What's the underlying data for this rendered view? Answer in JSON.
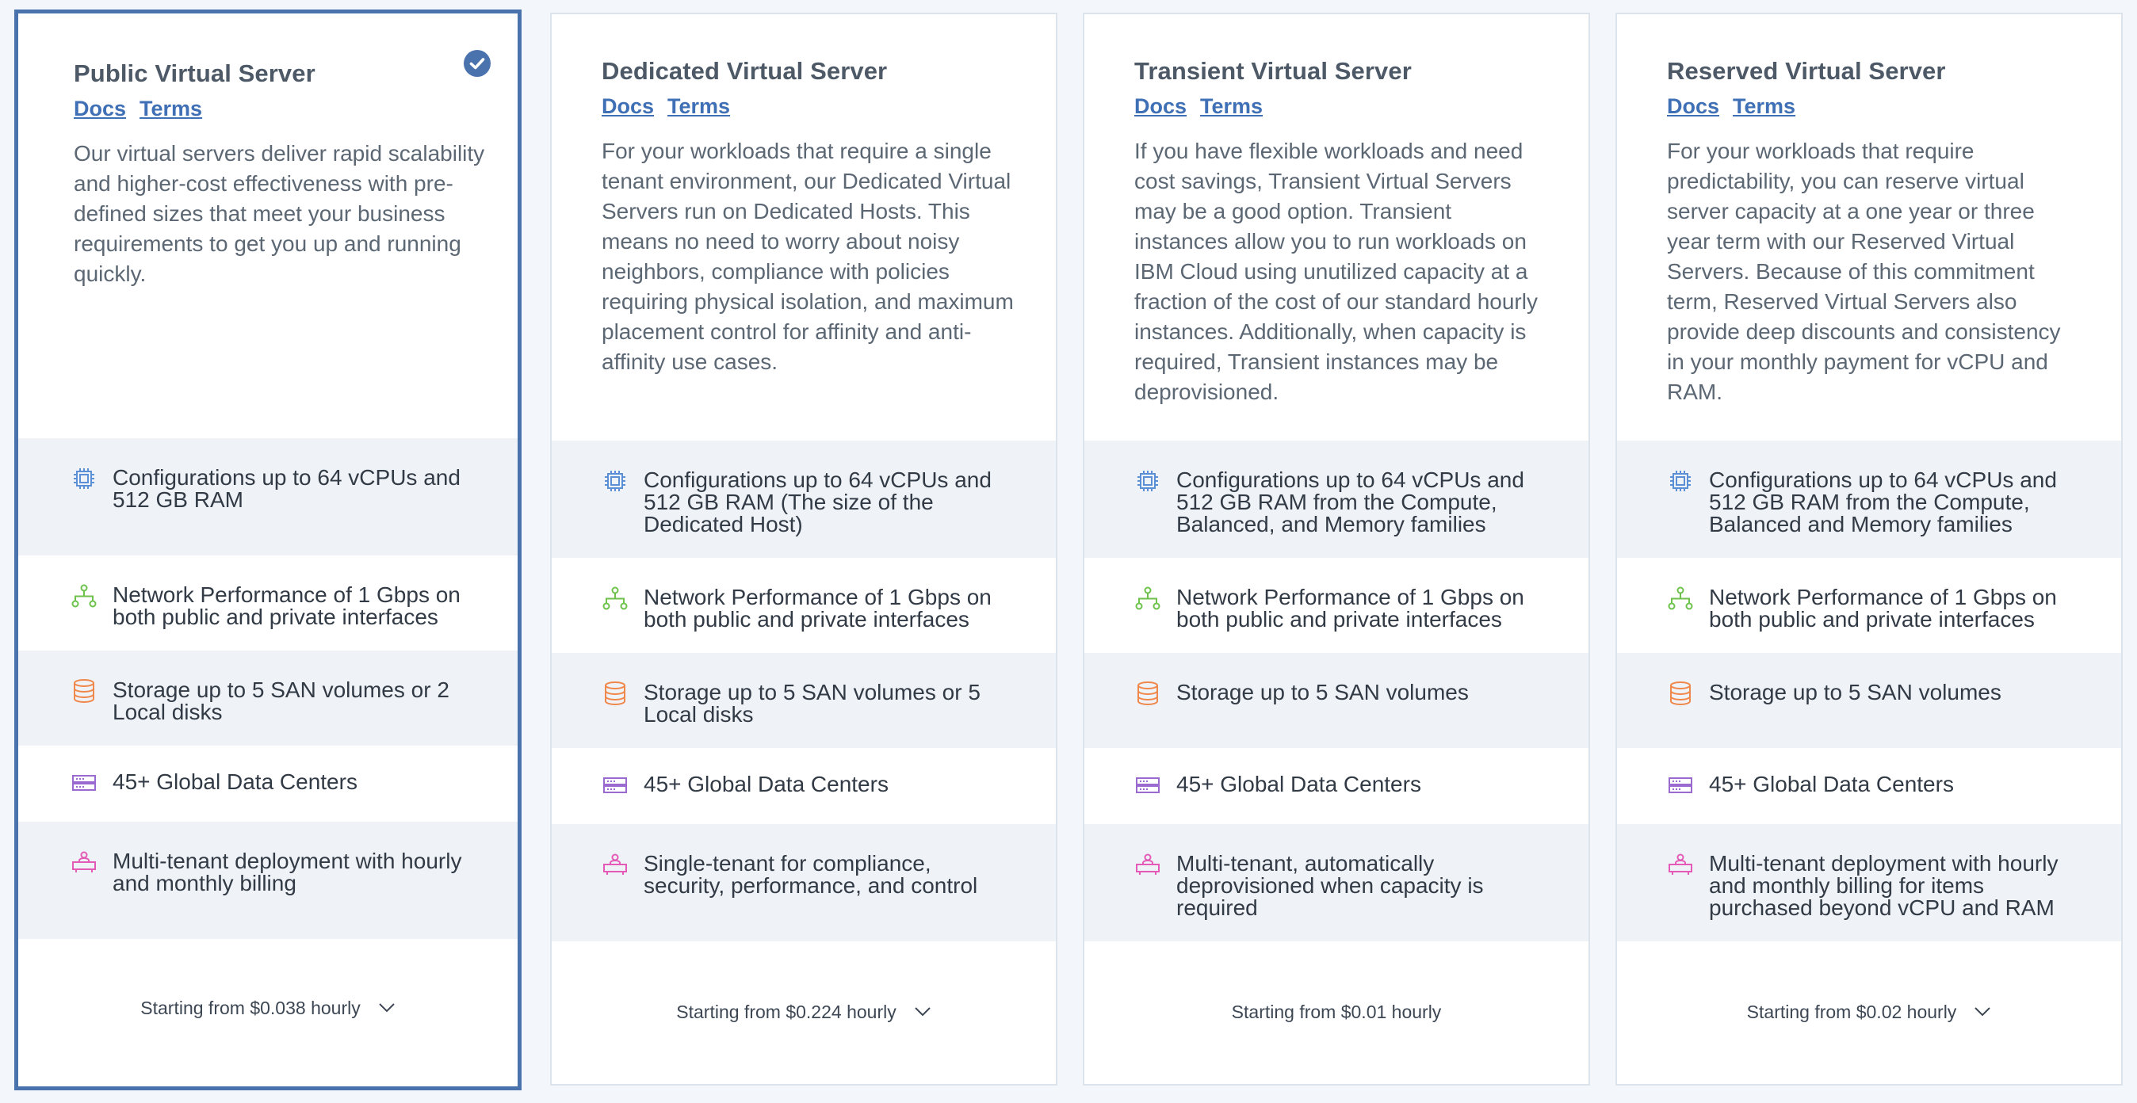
{
  "cards": [
    {
      "title": "Public Virtual Server",
      "docs": "Docs",
      "terms": "Terms",
      "description": "Our virtual servers deliver rapid scalability and higher-cost effectiveness with pre-defined sizes that meet your business requirements to get you up and running quickly.",
      "features": [
        "Configurations up to 64 vCPUs and 512 GB RAM",
        "Network Performance of 1 Gbps on both public and private interfaces",
        "Storage up to 5 SAN volumes or 2 Local disks",
        "45+ Global Data Centers",
        "Multi-tenant deployment with hourly and monthly billing"
      ],
      "price": "Starting from $0.038 hourly",
      "selected": true
    },
    {
      "title": "Dedicated Virtual Server",
      "docs": "Docs",
      "terms": "Terms",
      "description": "For your workloads that require a single tenant environment, our Dedicated Virtual Servers run on Dedicated Hosts. This means no need to worry about noisy neighbors, compliance with policies requiring physical isolation, and maximum placement control for affinity and anti-affinity use cases.",
      "features": [
        "Configurations up to 64 vCPUs and 512 GB RAM (The size of the Dedicated Host)",
        "Network Performance of 1 Gbps on both public and private interfaces",
        "Storage up to 5 SAN volumes or 5 Local disks",
        "45+ Global Data Centers",
        "Single-tenant for compliance, security, performance, and control"
      ],
      "price": "Starting from $0.224 hourly",
      "selected": false
    },
    {
      "title": "Transient Virtual Server",
      "docs": "Docs",
      "terms": "Terms",
      "description": "If you have flexible workloads and need cost savings, Transient Virtual Servers may be a good option. Transient instances allow you to run workloads on IBM Cloud using unutilized capacity at a fraction of the cost of our standard hourly instances. Additionally, when capacity is required, Transient instances may be deprovisioned.",
      "features": [
        "Configurations up to 64 vCPUs and 512 GB RAM from the Compute, Balanced, and Memory families",
        "Network Performance of 1 Gbps on both public and private interfaces",
        "Storage up to 5 SAN volumes",
        "45+ Global Data Centers",
        "Multi-tenant, automatically deprovisioned when capacity is required"
      ],
      "price": "Starting from $0.01 hourly",
      "selected": false
    },
    {
      "title": "Reserved Virtual Server",
      "docs": "Docs",
      "terms": "Terms",
      "description": "For your workloads that require predictability, you can reserve virtual server capacity at a one year or three year term with our Reserved Virtual Servers. Because of this commitment term, Reserved Virtual Servers also provide deep discounts and consistency in your monthly payment for vCPU and RAM.",
      "features": [
        "Configurations up to 64 vCPUs and 512 GB RAM from the Compute, Balanced and Memory families",
        "Network Performance of 1 Gbps on both public and private interfaces",
        "Storage up to 5 SAN volumes",
        "45+ Global Data Centers",
        "Multi-tenant deployment with hourly and monthly billing for items purchased beyond vCPU and RAM"
      ],
      "price": "Starting from $0.02 hourly",
      "selected": false
    }
  ],
  "icons": {
    "feature_icons": [
      "cpu-icon",
      "network-icon",
      "storage-icon",
      "data-center-icon",
      "tenant-icon"
    ],
    "selected_icon": "checkmark-icon",
    "expand_icon": "chevron-down-icon"
  },
  "colors": {
    "accent": "#4a72ad",
    "cpu": "#5b8fd6",
    "network": "#6dc24b",
    "storage": "#f0874b",
    "datacenter": "#9a6ad0",
    "tenant": "#e35bb6"
  }
}
